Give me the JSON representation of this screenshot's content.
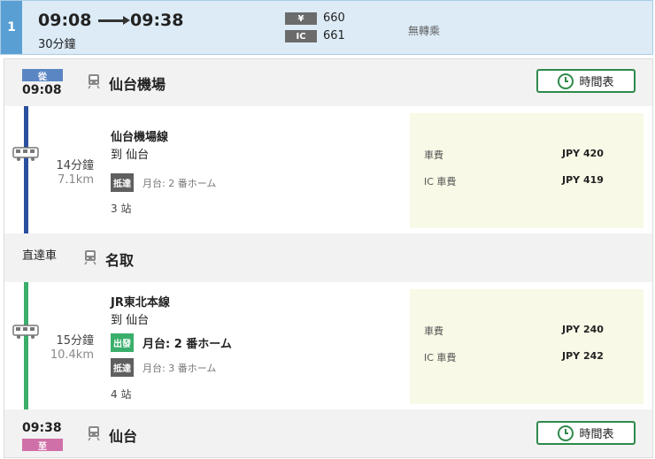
{
  "header": {
    "route_number": "1",
    "departure": "09:08",
    "arrival": "09:38",
    "duration": "30分鐘",
    "fare_cash_badge": "¥",
    "fare_cash": "660",
    "fare_ic_badge": "IC",
    "fare_ic": "661",
    "transfer_text": "無轉乘"
  },
  "origin": {
    "tag": "從",
    "time": "09:08",
    "station": "仙台機場",
    "timetable_label": "時間表"
  },
  "segments": [
    {
      "line_color": "#2a4f9e",
      "duration": "14分鐘",
      "distance": "7.1km",
      "line_name": "仙台機場線",
      "destination": "到 仙台",
      "arrive_pill": "抵達",
      "arrive_platform": "月台: 2 番ホーム",
      "stops": "3 站",
      "fare_label": "車費",
      "fare_value": "JPY 420",
      "ic_label": "IC 車費",
      "ic_value": "JPY 419"
    },
    {
      "line_color": "#3aae6a",
      "duration": "15分鐘",
      "distance": "10.4km",
      "line_name": "JR東北本線",
      "destination": "到 仙台",
      "depart_pill": "出發",
      "depart_platform": "月台: 2 番ホーム",
      "arrive_pill": "抵達",
      "arrive_platform": "月台: 3 番ホーム",
      "stops": "4 站",
      "fare_label": "車費",
      "fare_value": "JPY 240",
      "ic_label": "IC 車費",
      "ic_value": "JPY 242"
    }
  ],
  "transfer_stop": {
    "label": "直達車",
    "station": "名取"
  },
  "destination": {
    "tag": "至",
    "time": "09:38",
    "station": "仙台",
    "timetable_label": "時間表"
  },
  "colors": {
    "from_tag": "#5a86c4",
    "to_tag": "#d070a8",
    "arrive_pill": "#5f5f5f",
    "depart_pill": "#3aae6a",
    "timetable_border": "#2e8a4a"
  }
}
